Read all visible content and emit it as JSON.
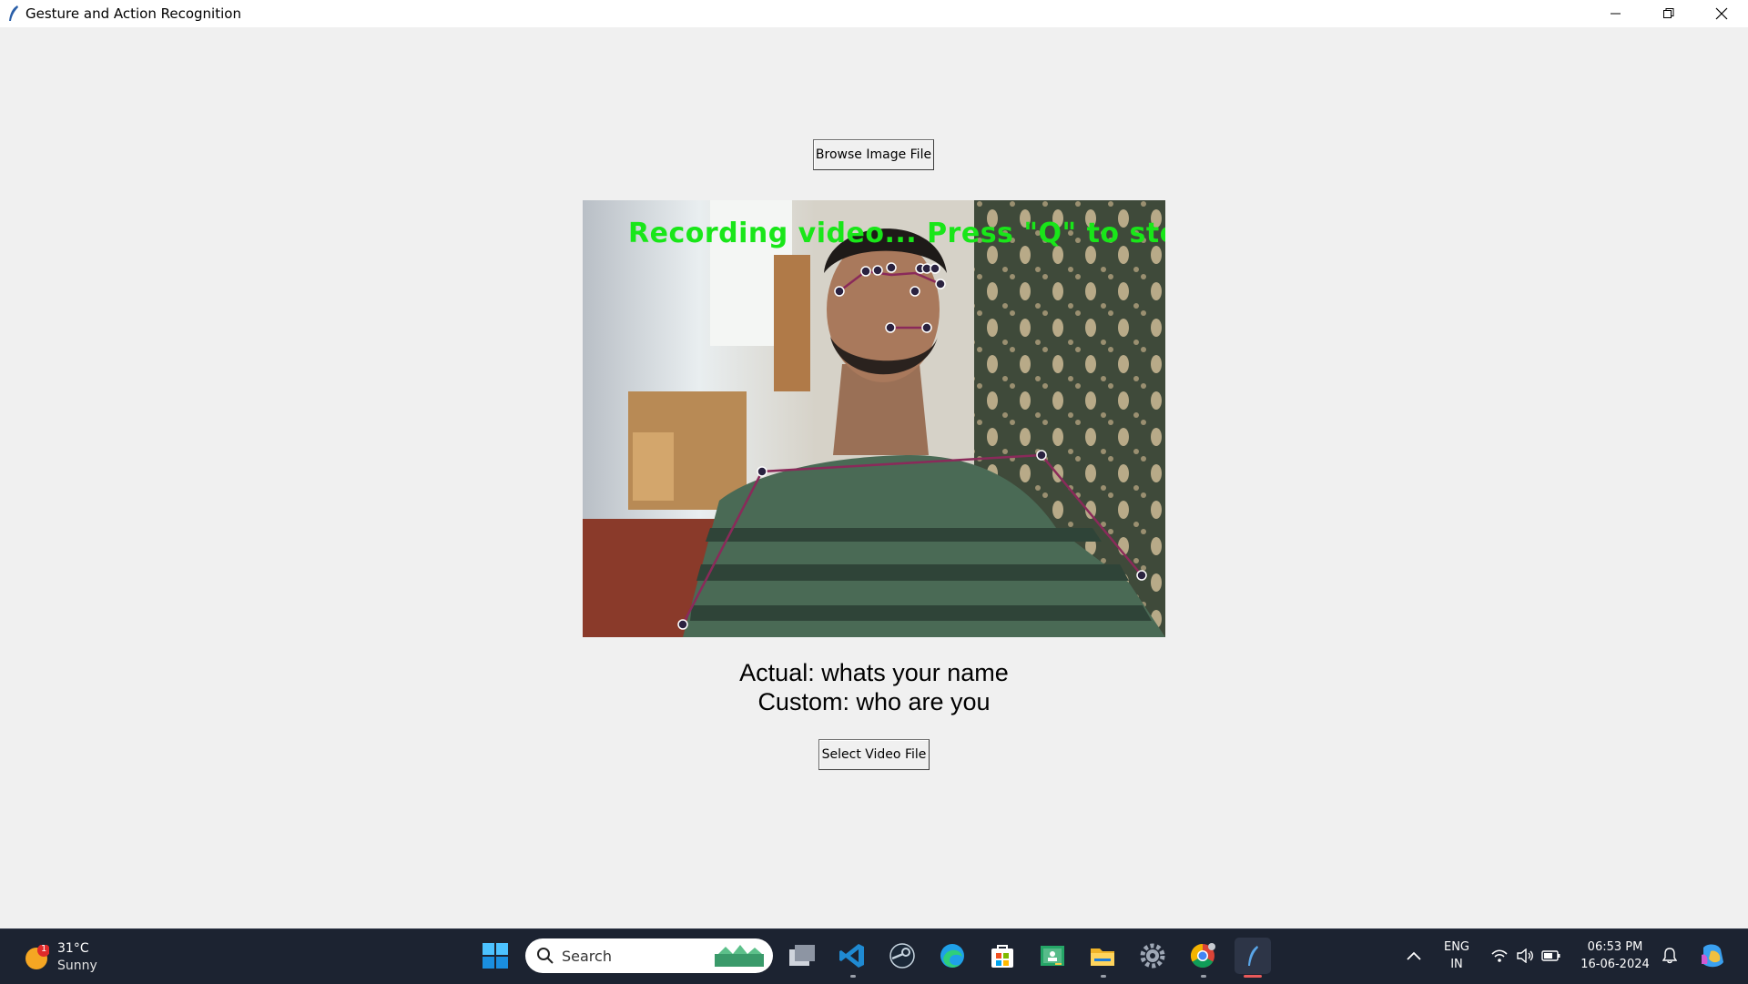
{
  "window": {
    "title": "Gesture and Action Recognition",
    "controls": [
      "minimize-icon",
      "restore-icon",
      "close-icon"
    ]
  },
  "main": {
    "browse_button": "Browse Image File",
    "video_overlay_text": "Recording video... Press \"Q\" to stop!",
    "actual_label": "Actual: whats your name",
    "custom_label": "Custom: who are you",
    "select_button": "Select Video File"
  },
  "taskbar": {
    "weather": {
      "temp": "31°C",
      "condition": "Sunny",
      "badge": "1"
    },
    "search_placeholder": "Search",
    "apps": [
      "windows-start-icon",
      "search-icon",
      "task-view-icon",
      "vscode-icon",
      "steam-icon",
      "edge-icon",
      "microsoft-store-icon",
      "google-classroom-icon",
      "file-explorer-icon",
      "settings-icon",
      "chrome-icon",
      "python-tk-app-icon"
    ],
    "language": {
      "line1": "ENG",
      "line2": "IN"
    },
    "clock": {
      "time": "06:53 PM",
      "date": "16-06-2024"
    }
  },
  "colors": {
    "overlay_text": "#19e619",
    "skeleton_line": "#8a2a5a",
    "taskbar_bg": "#1c2331"
  }
}
